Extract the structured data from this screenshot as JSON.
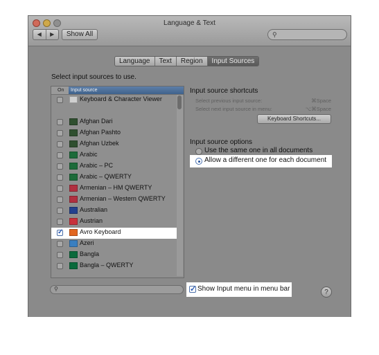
{
  "window": {
    "title": "Language & Text"
  },
  "toolbar": {
    "back": "◀",
    "forward": "▶",
    "show_all": "Show All",
    "search_icon": "search-icon"
  },
  "tabs": [
    {
      "label": "Language",
      "active": false
    },
    {
      "label": "Text",
      "active": false
    },
    {
      "label": "Region",
      "active": false
    },
    {
      "label": "Input Sources",
      "active": true
    }
  ],
  "prompt": "Select input sources to use.",
  "list": {
    "col_on": "On",
    "col_source": "Input source",
    "items": [
      {
        "label": "Keyboard & Character Viewer",
        "checked": false,
        "icon": "keyboard-viewer-icon",
        "color": "#cfcfcf"
      },
      {
        "label": "Afghan Dari",
        "checked": false,
        "icon": "flag-afghanistan",
        "color": "#2f4f2f"
      },
      {
        "label": "Afghan Pashto",
        "checked": false,
        "icon": "flag-afghanistan",
        "color": "#2f4f2f"
      },
      {
        "label": "Afghan Uzbek",
        "checked": false,
        "icon": "flag-afghanistan",
        "color": "#2f4f2f"
      },
      {
        "label": "Arabic",
        "checked": false,
        "icon": "arabic-icon",
        "color": "#1d6b3a"
      },
      {
        "label": "Arabic – PC",
        "checked": false,
        "icon": "arabic-icon",
        "color": "#1d6b3a"
      },
      {
        "label": "Arabic – QWERTY",
        "checked": false,
        "icon": "arabic-icon",
        "color": "#1d6b3a"
      },
      {
        "label": "Armenian – HM QWERTY",
        "checked": false,
        "icon": "flag-armenia",
        "color": "#b03040"
      },
      {
        "label": "Armenian – Western QWERTY",
        "checked": false,
        "icon": "flag-armenia",
        "color": "#b03040"
      },
      {
        "label": "Australian",
        "checked": false,
        "icon": "flag-australia",
        "color": "#23408e"
      },
      {
        "label": "Austrian",
        "checked": false,
        "icon": "flag-austria",
        "color": "#c8323c"
      },
      {
        "label": "Avro Keyboard",
        "checked": true,
        "icon": "avro-icon",
        "color": "#e2661f"
      },
      {
        "label": "Azeri",
        "checked": false,
        "icon": "flag-azerbaijan",
        "color": "#3a7fc0"
      },
      {
        "label": "Bangla",
        "checked": false,
        "icon": "flag-bangladesh",
        "color": "#0a6a3c"
      },
      {
        "label": "Bangla – QWERTY",
        "checked": false,
        "icon": "flag-bangladesh",
        "color": "#0a6a3c"
      }
    ]
  },
  "shortcuts": {
    "title": "Input source shortcuts",
    "prev_label": "Select previous input source:",
    "prev_key": "⌘Space",
    "next_label": "Select next input source in menu:",
    "next_key": "⌥⌘Space",
    "button": "Keyboard Shortcuts..."
  },
  "options": {
    "title": "Input source options",
    "opt1": "Use the same one in all documents",
    "opt2": "Allow a different one for each document",
    "selected": 2
  },
  "bottom": {
    "show_menu": "Show Input menu in menu bar",
    "show_menu_checked": true,
    "help": "?"
  }
}
